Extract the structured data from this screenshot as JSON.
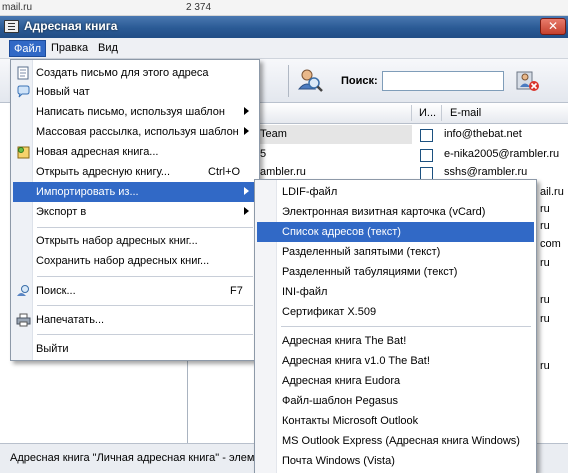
{
  "background_window": {
    "left_text": "mail.ru",
    "number": "2 374"
  },
  "window": {
    "title": "Адресная книга"
  },
  "menubar": {
    "items": [
      "Файл",
      "Правка",
      "Вид"
    ]
  },
  "toolbar": {
    "search_label": "Поиск:",
    "search_value": ""
  },
  "list": {
    "columns": [
      "И...",
      "E-mail"
    ],
    "rows": [
      {
        "name": "Team",
        "email": "info@thebat.net"
      },
      {
        "name": "5",
        "email": "e-nika2005@rambler.ru"
      },
      {
        "name": "ambler.ru",
        "email": "sshs@rambler.ru"
      }
    ],
    "email_fragments": [
      "ail.ru",
      "ru",
      "ru",
      "ru",
      "com",
      "ru",
      "ru",
      "ru",
      "ru"
    ]
  },
  "file_menu": {
    "items": [
      {
        "label": "Создать письмо для этого адреса",
        "icon": "new-letter-icon"
      },
      {
        "label": "Новый чат",
        "icon": "chat-icon"
      },
      {
        "label": "Написать письмо, используя шаблон",
        "submenu": true
      },
      {
        "label": "Массовая рассылка, используя шаблон",
        "submenu": true
      },
      {
        "label": "Новая адресная книга...",
        "icon": "new-book-icon"
      },
      {
        "label": "Открыть адресную книгу...",
        "shortcut": "Ctrl+O"
      },
      {
        "label": "Импортировать из...",
        "submenu": true
      },
      {
        "label": "Экспорт в",
        "submenu": true
      },
      {
        "label": "Открыть набор адресных книг..."
      },
      {
        "label": "Сохранить набор адресных книг..."
      },
      {
        "label": "Поиск...",
        "shortcut": "F7",
        "icon": "search-icon"
      },
      {
        "label": "Напечатать...",
        "icon": "printer-icon"
      },
      {
        "label": "Выйти"
      }
    ]
  },
  "import_menu": {
    "items": [
      "LDIF-файл",
      "Электронная визитная карточка (vCard)",
      "Список адресов (текст)",
      "Разделенный запятыми (текст)",
      "Разделенный табуляциями (текст)",
      "INI-файл",
      "Сертификат X.509",
      "Адресная книга The Bat!",
      "Адресная книга v1.0 The Bat!",
      "Адресная книга Eudora",
      "Файл-шаблон Pegasus",
      "Контакты Microsoft Outlook",
      "MS Outlook Express (Адресная книга Windows)",
      "Почта Windows (Vista)"
    ]
  },
  "status": {
    "text": "Адресная книга \"Личная адресная книга\" - элем"
  },
  "colors": {
    "highlight": "#3169c6",
    "title_bar": "#2a5a95"
  }
}
